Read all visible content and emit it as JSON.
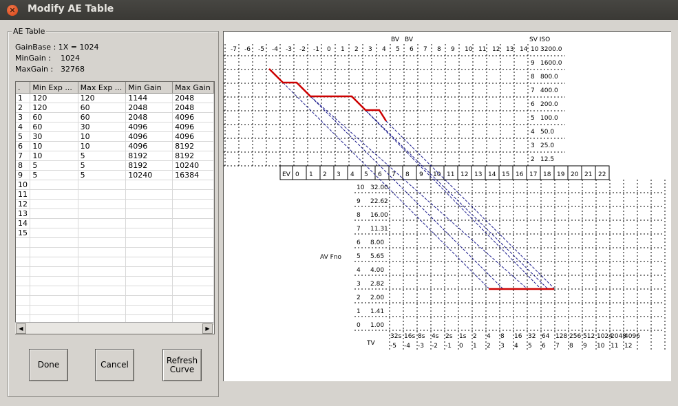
{
  "window": {
    "title": "Modify AE Table",
    "close_glyph": "×"
  },
  "group": {
    "label": "AE Table"
  },
  "info": {
    "gainbase": "GainBase : 1X = 1024",
    "mingain_label": "MinGain :",
    "mingain_value": "1024",
    "maxgain_label": "MaxGain :",
    "maxgain_value": "32768"
  },
  "table": {
    "columns": [
      ".",
      "Min Exp ...",
      "Max Exp ...",
      "Min Gain",
      "Max Gain"
    ],
    "rows": [
      [
        "1",
        "120",
        "120",
        "1144",
        "2048"
      ],
      [
        "2",
        "120",
        "60",
        "2048",
        "2048"
      ],
      [
        "3",
        "60",
        "60",
        "2048",
        "4096"
      ],
      [
        "4",
        "60",
        "30",
        "4096",
        "4096"
      ],
      [
        "5",
        "30",
        "10",
        "4096",
        "4096"
      ],
      [
        "6",
        "10",
        "10",
        "4096",
        "8192"
      ],
      [
        "7",
        "10",
        "5",
        "8192",
        "8192"
      ],
      [
        "8",
        "5",
        "5",
        "8192",
        "10240"
      ],
      [
        "9",
        "5",
        "5",
        "10240",
        "16384"
      ],
      [
        "10",
        "",
        "",
        "",
        ""
      ],
      [
        "11",
        "",
        "",
        "",
        ""
      ],
      [
        "12",
        "",
        "",
        "",
        ""
      ],
      [
        "13",
        "",
        "",
        "",
        ""
      ],
      [
        "14",
        "",
        "",
        "",
        ""
      ],
      [
        "15",
        "",
        "",
        "",
        ""
      ],
      [
        "",
        "",
        "",
        "",
        ""
      ],
      [
        "",
        "",
        "",
        "",
        ""
      ],
      [
        "",
        "",
        "",
        "",
        ""
      ],
      [
        "",
        "",
        "",
        "",
        ""
      ],
      [
        "",
        "",
        "",
        "",
        ""
      ],
      [
        "",
        "",
        "",
        "",
        ""
      ],
      [
        "",
        "",
        "",
        "",
        ""
      ],
      [
        "",
        "",
        "",
        "",
        ""
      ],
      [
        "",
        "",
        "",
        "",
        ""
      ]
    ],
    "scroll_left": "◀",
    "scroll_right": "▶"
  },
  "buttons": {
    "done": "Done",
    "cancel": "Cancel",
    "refresh_line1": "Refresh",
    "refresh_line2": "Curve"
  },
  "chart": {
    "top_bv_header": [
      "BV",
      "BV"
    ],
    "top_bv_numbers": [
      "-7",
      "-6",
      "-5",
      "-4",
      "-3",
      "-2",
      "-1",
      "0",
      "1",
      "2",
      "3",
      "4",
      "5",
      "6",
      "7",
      "8",
      "9",
      "10",
      "11",
      "12",
      "13",
      "14"
    ],
    "sv_header": "SV  ISO",
    "sv_rows": [
      {
        "sv": "10",
        "iso": "3200.0"
      },
      {
        "sv": "9",
        "iso": "1600.0"
      },
      {
        "sv": "8",
        "iso": "800.0"
      },
      {
        "sv": "7",
        "iso": "400.0"
      },
      {
        "sv": "6",
        "iso": "200.0"
      },
      {
        "sv": "5",
        "iso": "100.0"
      },
      {
        "sv": "4",
        "iso": "50.0"
      },
      {
        "sv": "3",
        "iso": "25.0"
      },
      {
        "sv": "2",
        "iso": "12.5"
      }
    ],
    "ev_label": "EV",
    "ev_numbers": [
      "0",
      "1",
      "2",
      "3",
      "4",
      "5",
      "6",
      "7",
      "8",
      "9",
      "10",
      "11",
      "12",
      "13",
      "14",
      "15",
      "16",
      "17",
      "18",
      "19",
      "20",
      "21",
      "22"
    ],
    "av_label": "AV Fno",
    "av_rows": [
      {
        "av": "10",
        "fno": "32.00"
      },
      {
        "av": "9",
        "fno": "22.62"
      },
      {
        "av": "8",
        "fno": "16.00"
      },
      {
        "av": "7",
        "fno": "11.31"
      },
      {
        "av": "6",
        "fno": "8.00"
      },
      {
        "av": "5",
        "fno": "5.65"
      },
      {
        "av": "4",
        "fno": "4.00"
      },
      {
        "av": "3",
        "fno": "2.82"
      },
      {
        "av": "2",
        "fno": "2.00"
      },
      {
        "av": "1",
        "fno": "1.41"
      },
      {
        "av": "0",
        "fno": "1.00"
      }
    ],
    "tv_label": "TV",
    "tv_times": [
      "32s",
      "16s",
      "8s",
      "4s",
      "2s",
      "1s",
      "2",
      "4",
      "8",
      "16",
      "32",
      "64",
      "128",
      "256",
      "512",
      "1024",
      "2048",
      "4096"
    ],
    "tv_numbers": [
      "-5",
      "-4",
      "-3",
      "-2",
      "-1",
      "0",
      "1",
      "2",
      "3",
      "4",
      "5",
      "6",
      "7",
      "8",
      "9",
      "10",
      "11",
      "12"
    ],
    "colors": {
      "curve": "#cc0000",
      "projection": "#1a1a8c",
      "grid": "#000000"
    }
  }
}
